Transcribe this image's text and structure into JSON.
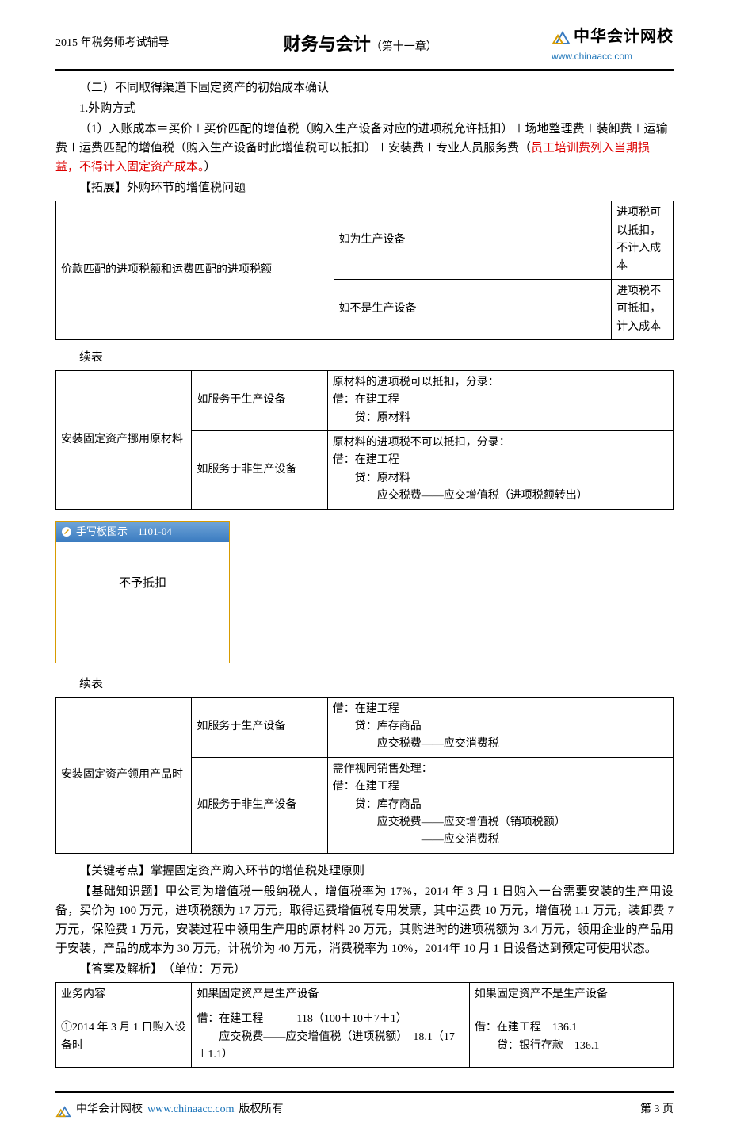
{
  "header": {
    "left": "2015 年税务师考试辅导",
    "center_main": "财务与会计",
    "center_sub": "（第十一章）",
    "brand": "中华会计网校",
    "brand_url": "www.chinaacc.com"
  },
  "section_title": "（二）不同取得渠道下固定资产的初始成本确认",
  "subtitle_1": "1.外购方式",
  "para_1a": "（1）入账成本＝买价＋买价匹配的增值税（购入生产设备对应的进项税允许抵扣）＋场地整理费＋装卸费＋运输费＋运费匹配的增值税（购入生产设备时此增值税可以抵扣）＋安装费＋专业人员服务费（",
  "para_1b": "员工培训费列入当期损益，不得计入固定资产成本。",
  "para_1c": "）",
  "expand_label": "【拓展】外购环节的增值税问题",
  "table1": {
    "r1c1": "价款匹配的进项税额和运费匹配的进项税额",
    "r1c2": "如为生产设备",
    "r1c3": "进项税可以抵扣，不计入成本",
    "r2c2": "如不是生产设备",
    "r2c3": "进项税不可抵扣，计入成本"
  },
  "continuation": "续表",
  "table2": {
    "r1c1": "安装固定资产挪用原材料",
    "r1c2": "如服务于生产设备",
    "r1c3_l1": "原材料的进项税可以抵扣，分录：",
    "r1c3_l2": "借：在建工程",
    "r1c3_l3": "　　贷：原材料",
    "r2c2": "如服务于非生产设备",
    "r2c3_l1": "原材料的进项税不可以抵扣，分录：",
    "r2c3_l2": "借：在建工程",
    "r2c3_l3": "　　贷：原材料",
    "r2c3_l4": "　　　　应交税费——应交增值税（进项税额转出）"
  },
  "panel": {
    "title": "手写板图示　1101-04",
    "body": "不予抵扣"
  },
  "table3": {
    "r1c1": "安装固定资产领用产品时",
    "r1c2": "如服务于生产设备",
    "r1c3_l1": "借：在建工程",
    "r1c3_l2": "　　贷：库存商品",
    "r1c3_l3": "　　　　应交税费——应交消费税",
    "r2c2": "如服务于非生产设备",
    "r2c3_l1": "需作视同销售处理：",
    "r2c3_l2": "借：在建工程",
    "r2c3_l3": "　　贷：库存商品",
    "r2c3_l4": "　　　　应交税费——应交增值税（销项税额）",
    "r2c3_l5": "　　　　　　　　——应交消费税"
  },
  "keypoint": "【关键考点】掌握固定资产购入环节的增值税处理原则",
  "basic_q": "【基础知识题】甲公司为增值税一般纳税人，增值税率为 17%，2014 年 3 月 1 日购入一台需要安装的生产用设备，买价为 100 万元，进项税额为 17 万元，取得运费增值税专用发票，其中运费 10 万元，增值税 1.1 万元，装卸费 7 万元，保险费 1 万元，安装过程中领用生产用的原材料 20 万元，其购进时的进项税额为 3.4 万元，领用企业的产品用于安装，产品的成本为 30 万元，计税价为 40 万元，消费税率为 10%，2014年 10 月 1 日设备达到预定可使用状态。",
  "answer_label": "【答案及解析】　（单位：万元）",
  "table4": {
    "h1": "业务内容",
    "h2": "如果固定资产是生产设备",
    "h3": "如果固定资产不是生产设备",
    "r1c1": "①2014 年 3 月 1 日购入设备时",
    "r1c2_l1": "借：在建工程　　　118（100＋10＋7＋1）",
    "r1c2_l2": "　　应交税费——应交增值税（进项税额）　18.1（17＋1.1）",
    "r1c3_l1": "借：在建工程　136.1",
    "r1c3_l2": "　　贷：银行存款　136.1"
  },
  "footer": {
    "brand": "中华会计网校",
    "url": "www.chinaacc.com",
    "copyright": "版权所有",
    "page": "第 3 页"
  }
}
